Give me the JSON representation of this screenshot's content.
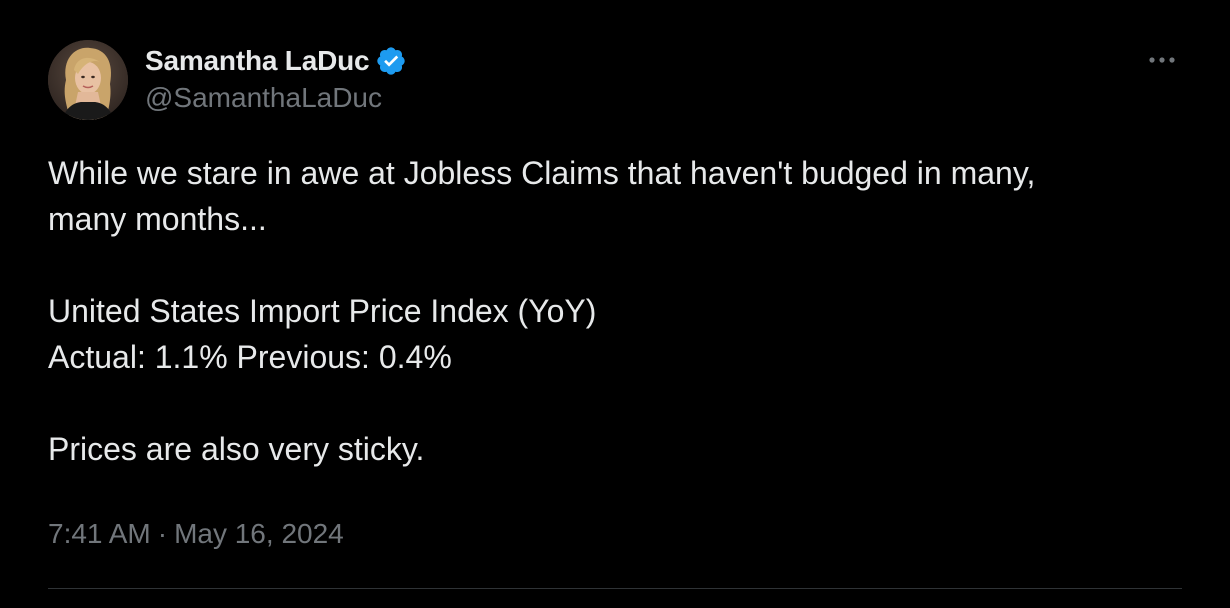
{
  "author": {
    "display_name": "Samantha LaDuc",
    "handle": "@SamanthaLaDuc",
    "verified": true,
    "verified_color": "#1d9bf0",
    "avatar_icon": "avatar-portrait"
  },
  "tweet": {
    "lines": [
      "While we stare in awe at Jobless Claims that haven't budged in many,",
      "many months...",
      "United States Import Price Index (YoY)",
      "Actual: 1.1% Previous: 0.4%",
      "Prices are also very sticky."
    ],
    "time": "7:41 AM",
    "separator": "·",
    "date": "May 16, 2024"
  },
  "menu": {
    "icon": "more-horizontal-icon"
  },
  "colors": {
    "background": "#000000",
    "text": "#e7e9ea",
    "secondary_text": "#71767b",
    "divider": "#2f3336"
  }
}
